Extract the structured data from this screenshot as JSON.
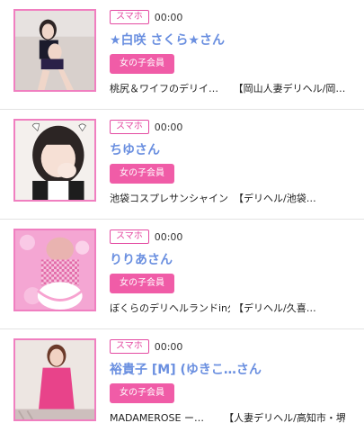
{
  "entries": [
    {
      "badge": "スマホ",
      "time": "00:00",
      "name": "★白咲 さくら★さん",
      "member_label": "女の子会員",
      "shop_line": "桃尻＆ワイフのデリイ…",
      "area_line": "【岡山人妻デリヘル/岡…",
      "thumb_colors": [
        "#d9d0cf",
        "#1c1c2e",
        "#f1d9cc"
      ]
    },
    {
      "badge": "スマホ",
      "time": "00:00",
      "name": "ちゆさん",
      "member_label": "女の子会員",
      "shop_line": "池袋コスプレサンシャイン（…",
      "area_line": "【デリヘル/池袋…",
      "thumb_colors": [
        "#f4f1ee",
        "#2a2a2a",
        "#f6e2d8"
      ]
    },
    {
      "badge": "スマホ",
      "time": "00:00",
      "name": "りりあさん",
      "member_label": "女の子会員",
      "shop_line": "ぼくらのデリヘルランドin久…",
      "area_line": "【デリヘル/久喜…",
      "thumb_colors": [
        "#f7a9d7",
        "#e27bb8",
        "#f3d0cf"
      ]
    },
    {
      "badge": "スマホ",
      "time": "00:00",
      "name": "裕貴子 [M] (ゆきこ…さん",
      "member_label": "女の子会員",
      "shop_line": "MADAMEROSE ー…",
      "area_line": "【人妻デリヘル/高知市・堺…",
      "thumb_colors": [
        "#efe7e3",
        "#e8428a",
        "#f2d3c6"
      ]
    }
  ]
}
